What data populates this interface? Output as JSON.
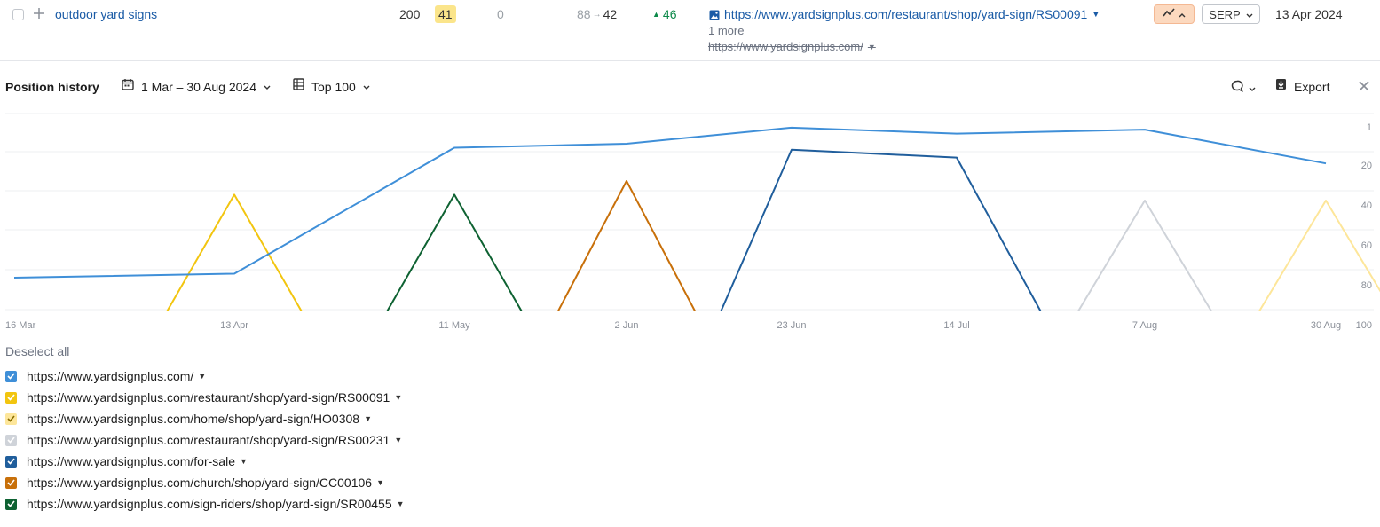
{
  "row": {
    "keyword": "outdoor yard signs",
    "volume": "200",
    "kd": "41",
    "cpc": "0",
    "position_from": "88",
    "position_to": "42",
    "change": "46",
    "url": "https://www.yardsignplus.com/restaurant/shop/yard-sign/RS00091",
    "more": "1 more",
    "prev_url": "https://www.yardsignplus.com/",
    "serp_label": "SERP",
    "date": "13 Apr 2024"
  },
  "toolbar": {
    "title": "Position history",
    "date_range": "1 Mar – 30 Aug 2024",
    "top_filter": "Top 100",
    "export_label": "Export"
  },
  "legend": {
    "deselect_label": "Deselect all"
  },
  "colors": {
    "accent_link": "#1a5ba6",
    "kd_badge": "#fbe58b",
    "positive": "#0d8a4a"
  },
  "icons": [
    "plus-icon",
    "image-icon",
    "trend-icon",
    "chevron-down-icon",
    "calendar-icon",
    "table-icon",
    "comment-icon",
    "download-icon",
    "close-icon",
    "caret-down-icon",
    "check-icon"
  ],
  "chart_data": {
    "type": "line",
    "x_labels": [
      "16 Mar",
      "13 Apr",
      "11 May",
      "2 Jun",
      "23 Jun",
      "14 Jul",
      "7 Aug",
      "30 Aug"
    ],
    "y_ticks": [
      "1",
      "20",
      "40",
      "60",
      "80",
      "100"
    ],
    "y_range": [
      1,
      100
    ],
    "y_inverted": true,
    "grid": true,
    "series": [
      {
        "name": "https://www.yardsignplus.com/",
        "color": "#3f8fd8",
        "points": [
          [
            "16 Mar",
            84
          ],
          [
            "13 Apr",
            82
          ],
          [
            "11 May",
            18
          ],
          [
            "2 Jun",
            16
          ],
          [
            "23 Jun",
            8
          ],
          [
            "14 Jul",
            11
          ],
          [
            "7 Aug",
            9
          ],
          [
            "30 Aug",
            26
          ]
        ]
      },
      {
        "name": "https://www.yardsignplus.com/restaurant/shop/yard-sign/RS00091",
        "color": "#f2c50f",
        "points": [
          [
            "13 Apr",
            42
          ]
        ]
      },
      {
        "name": "https://www.yardsignplus.com/home/shop/yard-sign/HO0308",
        "color": "#fde69a",
        "points": [
          [
            "30 Aug",
            45
          ]
        ]
      },
      {
        "name": "https://www.yardsignplus.com/restaurant/shop/yard-sign/RS00231",
        "color": "#cfd3d9",
        "points": [
          [
            "7 Aug",
            45
          ]
        ]
      },
      {
        "name": "https://www.yardsignplus.com/for-sale",
        "color": "#205e9c",
        "points": [
          [
            "23 Jun",
            19
          ],
          [
            "14 Jul",
            23
          ]
        ]
      },
      {
        "name": "https://www.yardsignplus.com/church/shop/yard-sign/CC00106",
        "color": "#c8700a",
        "points": [
          [
            "2 Jun",
            35
          ]
        ]
      },
      {
        "name": "https://www.yardsignplus.com/sign-riders/shop/yard-sign/SR00455",
        "color": "#0e6232",
        "points": [
          [
            "11 May",
            42
          ]
        ]
      }
    ]
  }
}
